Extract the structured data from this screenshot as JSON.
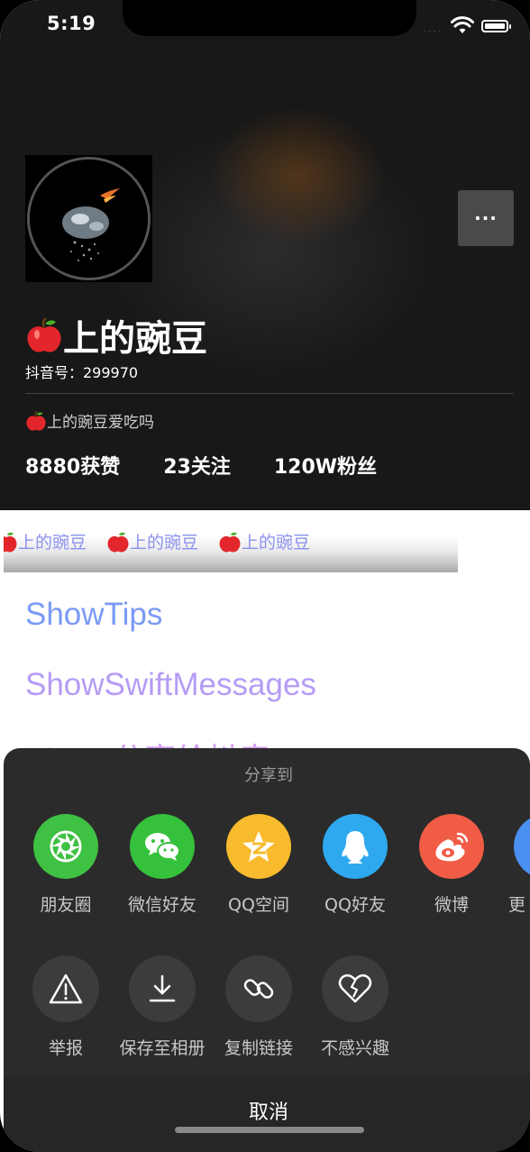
{
  "status_bar": {
    "time": "5:19"
  },
  "profile": {
    "name": "上的豌豆",
    "douyin_id": "抖音号：299970",
    "bio": "上的豌豆爱吃吗",
    "more_label": "···",
    "stats": {
      "likes": "8880获赞",
      "following": "23关注",
      "fans": "120W粉丝"
    }
  },
  "marquee": {
    "items": [
      "上的豌豆",
      "上的豌豆",
      "上的豌豆"
    ]
  },
  "links": {
    "show_tips": "ShowTips",
    "show_swift_messages": "ShowSwiftMessages",
    "third": "Show 分享给抖音"
  },
  "share_sheet": {
    "title": "分享到",
    "share_items": [
      {
        "label": "朋友圈",
        "icon": "moments-icon",
        "color": "#3fc143"
      },
      {
        "label": "微信好友",
        "icon": "wechat-icon",
        "color": "#36c13c"
      },
      {
        "label": "QQ空间",
        "icon": "qzone-icon",
        "color": "#f8bb2d"
      },
      {
        "label": "QQ好友",
        "icon": "qq-icon",
        "color": "#2ea9ef"
      },
      {
        "label": "微博",
        "icon": "weibo-icon",
        "color": "#f05c45"
      },
      {
        "label": "更",
        "icon": "more-share-icon",
        "color": "#4a90f0"
      }
    ],
    "actions": [
      {
        "label": "举报",
        "icon": "warning-icon"
      },
      {
        "label": "保存至相册",
        "icon": "download-icon"
      },
      {
        "label": "复制链接",
        "icon": "link-icon"
      },
      {
        "label": "不感兴趣",
        "icon": "broken-heart-icon"
      }
    ],
    "cancel": "取消"
  }
}
